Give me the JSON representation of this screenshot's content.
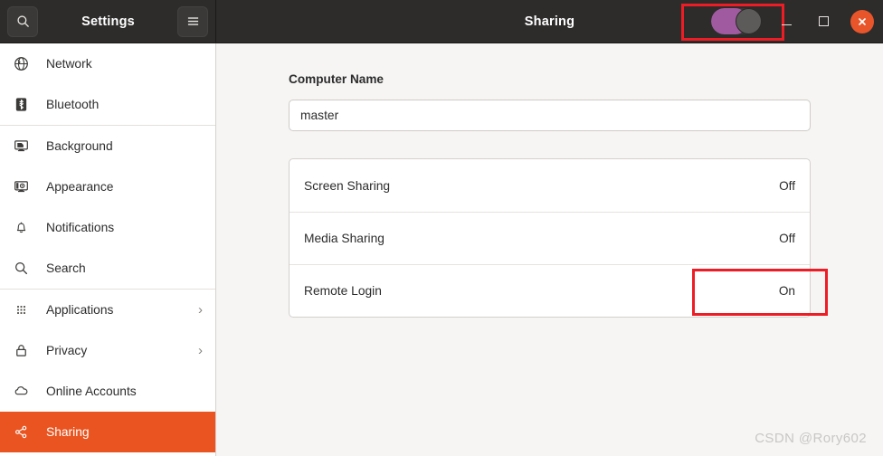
{
  "window": {
    "app_title": "Settings",
    "page_title": "Sharing",
    "search_icon": "search-icon",
    "menu_icon": "hamburger-menu-icon",
    "master_toggle": {
      "name": "sharing-master-toggle",
      "state": "On",
      "accent_color": "#a05ba0",
      "knob_color": "#5d5b59"
    },
    "controls": {
      "minimize": "minimize-icon",
      "maximize": "maximize-icon",
      "close": "close-icon",
      "close_color": "#e9552a"
    },
    "titlebar_color": "#2e2c2b"
  },
  "sidebar": {
    "active_color": "#e95420",
    "groups": [
      {
        "items": [
          {
            "label": "Network",
            "icon": "globe-icon",
            "chevron": "",
            "active": false
          },
          {
            "label": "Bluetooth",
            "icon": "bluetooth-icon",
            "chevron": "",
            "active": false
          }
        ]
      },
      {
        "items": [
          {
            "label": "Background",
            "icon": "monitor-wallpaper-icon",
            "chevron": "",
            "active": false
          },
          {
            "label": "Appearance",
            "icon": "monitor-appearance-icon",
            "chevron": "",
            "active": false
          },
          {
            "label": "Notifications",
            "icon": "bell-icon",
            "chevron": "",
            "active": false
          },
          {
            "label": "Search",
            "icon": "magnifier-icon",
            "chevron": "",
            "active": false
          }
        ]
      },
      {
        "items": [
          {
            "label": "Applications",
            "icon": "app-grid-icon",
            "chevron": "›",
            "active": false
          },
          {
            "label": "Privacy",
            "icon": "lock-icon",
            "chevron": "›",
            "active": false
          },
          {
            "label": "Online Accounts",
            "icon": "cloud-icon",
            "chevron": "",
            "active": false
          },
          {
            "label": "Sharing",
            "icon": "share-nodes-icon",
            "chevron": "",
            "active": true
          }
        ]
      }
    ]
  },
  "main": {
    "computer_name": {
      "label": "Computer Name",
      "value": "master",
      "placeholder": "Computer Name"
    },
    "options": [
      {
        "title": "Screen Sharing",
        "state": "Off",
        "highlighted": false
      },
      {
        "title": "Media Sharing",
        "state": "Off",
        "highlighted": false
      },
      {
        "title": "Remote Login",
        "state": "On",
        "highlighted": true
      }
    ],
    "highlight_color": "#ee1c25"
  },
  "watermark": {
    "text": "CSDN @Rory602"
  }
}
